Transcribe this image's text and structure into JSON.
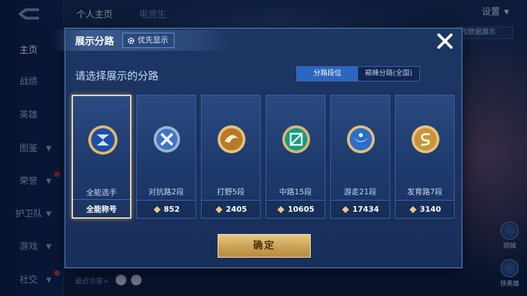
{
  "nav": {
    "items": [
      {
        "label": "主页",
        "active": true
      },
      {
        "label": "战绩"
      },
      {
        "label": "英雄"
      },
      {
        "label": "图鉴",
        "chevron": true
      },
      {
        "label": "荣誉",
        "chevron": true,
        "dot": true
      },
      {
        "label": "护卫队",
        "chevron": true
      },
      {
        "label": "游戏",
        "chevron": true
      },
      {
        "label": "社交",
        "chevron": true,
        "dot": true
      }
    ]
  },
  "top": {
    "tab_profile": "个人主页",
    "tab_esports": "电竞生",
    "settings_label": "设置",
    "corner_chip": "和数据展示"
  },
  "bottom": {
    "recent_visitors": "最近访客>"
  },
  "side_buttons": [
    {
      "label": "同城"
    },
    {
      "label": "快英雄"
    }
  ],
  "modal": {
    "title": "展示分路",
    "priority_label": "优先显示",
    "subtitle": "请选择展示的分路",
    "segments": [
      {
        "label": "分路段位",
        "active": true
      },
      {
        "label": "巅峰分路(全国)",
        "active": false
      }
    ],
    "cards": [
      {
        "label": "全能选手",
        "footer": "全能称号",
        "selected": true,
        "badge": "all-round-badge",
        "color": "#3b6fd4"
      },
      {
        "label": "对抗路2段",
        "footer": "852",
        "selected": false,
        "badge": "clash-lane-badge",
        "color": "#6f9fd8"
      },
      {
        "label": "打野5段",
        "footer": "2405",
        "selected": false,
        "badge": "jungle-badge",
        "color": "#d49a3b"
      },
      {
        "label": "中路15段",
        "footer": "10605",
        "selected": false,
        "badge": "mid-lane-badge",
        "color": "#1fa98a"
      },
      {
        "label": "游走21段",
        "footer": "17434",
        "selected": false,
        "badge": "roam-badge",
        "color": "#2f78d0"
      },
      {
        "label": "发育路7段",
        "footer": "3140",
        "selected": false,
        "badge": "farm-lane-badge",
        "color": "#d8a446"
      }
    ],
    "confirm_label": "确定"
  },
  "colors": {
    "accent_blue": "#2c66c2",
    "gold": "#cda459",
    "selected_border": "#f2d7a0"
  }
}
